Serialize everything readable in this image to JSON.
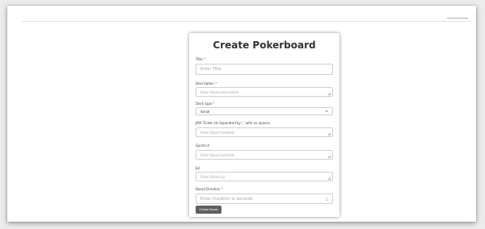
{
  "header": {
    "nav_link": ""
  },
  "form": {
    "title": "Create Pokerboard",
    "fields": [
      {
        "label": "Title",
        "required": "*",
        "placeholder": "Enter Title"
      },
      {
        "label": "Description",
        "required": "*",
        "placeholder": "Enter Board description"
      },
      {
        "label": "Deck type",
        "required": "*",
        "value": "Serial"
      },
      {
        "label": "JIRA Ticket ids Separated by ',' with no spaces",
        "required": "",
        "placeholder": "Enter Board ticketids"
      },
      {
        "label": "Sprint id",
        "required": "",
        "placeholder": "Enter Board sprintids"
      },
      {
        "label": "Jql",
        "required": "",
        "placeholder": "Enter Board jql"
      },
      {
        "label": "Board Duration",
        "required": "*",
        "placeholder": "Enter Duration in seconds"
      }
    ],
    "submit_label": "Create Board"
  }
}
